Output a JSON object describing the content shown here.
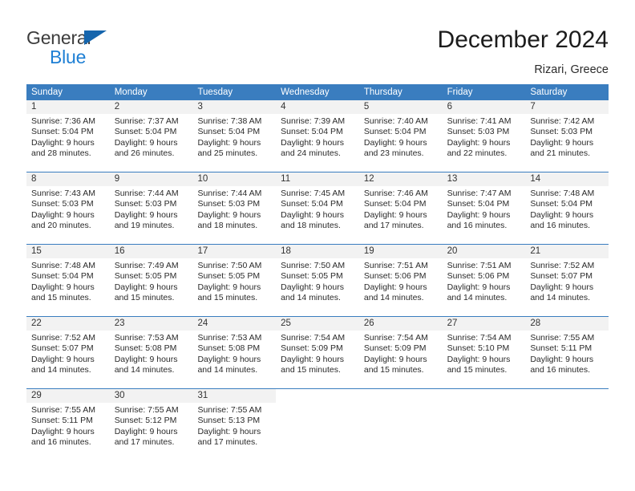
{
  "brand": {
    "name_part1": "General",
    "name_part2": "Blue",
    "triangle_color": "#1565ad",
    "blue_color": "#1e7fd4"
  },
  "header": {
    "title": "December 2024",
    "location": "Rizari, Greece"
  },
  "theme": {
    "header_blue": "#3a7dbf",
    "daynum_band": "#f2f2f2",
    "text": "#2a2a2a"
  },
  "calendar": {
    "weekday_headers": [
      "Sunday",
      "Monday",
      "Tuesday",
      "Wednesday",
      "Thursday",
      "Friday",
      "Saturday"
    ],
    "weeks": [
      [
        {
          "day": "1",
          "sunrise": "Sunrise: 7:36 AM",
          "sunset": "Sunset: 5:04 PM",
          "daylight1": "Daylight: 9 hours",
          "daylight2": "and 28 minutes."
        },
        {
          "day": "2",
          "sunrise": "Sunrise: 7:37 AM",
          "sunset": "Sunset: 5:04 PM",
          "daylight1": "Daylight: 9 hours",
          "daylight2": "and 26 minutes."
        },
        {
          "day": "3",
          "sunrise": "Sunrise: 7:38 AM",
          "sunset": "Sunset: 5:04 PM",
          "daylight1": "Daylight: 9 hours",
          "daylight2": "and 25 minutes."
        },
        {
          "day": "4",
          "sunrise": "Sunrise: 7:39 AM",
          "sunset": "Sunset: 5:04 PM",
          "daylight1": "Daylight: 9 hours",
          "daylight2": "and 24 minutes."
        },
        {
          "day": "5",
          "sunrise": "Sunrise: 7:40 AM",
          "sunset": "Sunset: 5:04 PM",
          "daylight1": "Daylight: 9 hours",
          "daylight2": "and 23 minutes."
        },
        {
          "day": "6",
          "sunrise": "Sunrise: 7:41 AM",
          "sunset": "Sunset: 5:03 PM",
          "daylight1": "Daylight: 9 hours",
          "daylight2": "and 22 minutes."
        },
        {
          "day": "7",
          "sunrise": "Sunrise: 7:42 AM",
          "sunset": "Sunset: 5:03 PM",
          "daylight1": "Daylight: 9 hours",
          "daylight2": "and 21 minutes."
        }
      ],
      [
        {
          "day": "8",
          "sunrise": "Sunrise: 7:43 AM",
          "sunset": "Sunset: 5:03 PM",
          "daylight1": "Daylight: 9 hours",
          "daylight2": "and 20 minutes."
        },
        {
          "day": "9",
          "sunrise": "Sunrise: 7:44 AM",
          "sunset": "Sunset: 5:03 PM",
          "daylight1": "Daylight: 9 hours",
          "daylight2": "and 19 minutes."
        },
        {
          "day": "10",
          "sunrise": "Sunrise: 7:44 AM",
          "sunset": "Sunset: 5:03 PM",
          "daylight1": "Daylight: 9 hours",
          "daylight2": "and 18 minutes."
        },
        {
          "day": "11",
          "sunrise": "Sunrise: 7:45 AM",
          "sunset": "Sunset: 5:04 PM",
          "daylight1": "Daylight: 9 hours",
          "daylight2": "and 18 minutes."
        },
        {
          "day": "12",
          "sunrise": "Sunrise: 7:46 AM",
          "sunset": "Sunset: 5:04 PM",
          "daylight1": "Daylight: 9 hours",
          "daylight2": "and 17 minutes."
        },
        {
          "day": "13",
          "sunrise": "Sunrise: 7:47 AM",
          "sunset": "Sunset: 5:04 PM",
          "daylight1": "Daylight: 9 hours",
          "daylight2": "and 16 minutes."
        },
        {
          "day": "14",
          "sunrise": "Sunrise: 7:48 AM",
          "sunset": "Sunset: 5:04 PM",
          "daylight1": "Daylight: 9 hours",
          "daylight2": "and 16 minutes."
        }
      ],
      [
        {
          "day": "15",
          "sunrise": "Sunrise: 7:48 AM",
          "sunset": "Sunset: 5:04 PM",
          "daylight1": "Daylight: 9 hours",
          "daylight2": "and 15 minutes."
        },
        {
          "day": "16",
          "sunrise": "Sunrise: 7:49 AM",
          "sunset": "Sunset: 5:05 PM",
          "daylight1": "Daylight: 9 hours",
          "daylight2": "and 15 minutes."
        },
        {
          "day": "17",
          "sunrise": "Sunrise: 7:50 AM",
          "sunset": "Sunset: 5:05 PM",
          "daylight1": "Daylight: 9 hours",
          "daylight2": "and 15 minutes."
        },
        {
          "day": "18",
          "sunrise": "Sunrise: 7:50 AM",
          "sunset": "Sunset: 5:05 PM",
          "daylight1": "Daylight: 9 hours",
          "daylight2": "and 14 minutes."
        },
        {
          "day": "19",
          "sunrise": "Sunrise: 7:51 AM",
          "sunset": "Sunset: 5:06 PM",
          "daylight1": "Daylight: 9 hours",
          "daylight2": "and 14 minutes."
        },
        {
          "day": "20",
          "sunrise": "Sunrise: 7:51 AM",
          "sunset": "Sunset: 5:06 PM",
          "daylight1": "Daylight: 9 hours",
          "daylight2": "and 14 minutes."
        },
        {
          "day": "21",
          "sunrise": "Sunrise: 7:52 AM",
          "sunset": "Sunset: 5:07 PM",
          "daylight1": "Daylight: 9 hours",
          "daylight2": "and 14 minutes."
        }
      ],
      [
        {
          "day": "22",
          "sunrise": "Sunrise: 7:52 AM",
          "sunset": "Sunset: 5:07 PM",
          "daylight1": "Daylight: 9 hours",
          "daylight2": "and 14 minutes."
        },
        {
          "day": "23",
          "sunrise": "Sunrise: 7:53 AM",
          "sunset": "Sunset: 5:08 PM",
          "daylight1": "Daylight: 9 hours",
          "daylight2": "and 14 minutes."
        },
        {
          "day": "24",
          "sunrise": "Sunrise: 7:53 AM",
          "sunset": "Sunset: 5:08 PM",
          "daylight1": "Daylight: 9 hours",
          "daylight2": "and 14 minutes."
        },
        {
          "day": "25",
          "sunrise": "Sunrise: 7:54 AM",
          "sunset": "Sunset: 5:09 PM",
          "daylight1": "Daylight: 9 hours",
          "daylight2": "and 15 minutes."
        },
        {
          "day": "26",
          "sunrise": "Sunrise: 7:54 AM",
          "sunset": "Sunset: 5:09 PM",
          "daylight1": "Daylight: 9 hours",
          "daylight2": "and 15 minutes."
        },
        {
          "day": "27",
          "sunrise": "Sunrise: 7:54 AM",
          "sunset": "Sunset: 5:10 PM",
          "daylight1": "Daylight: 9 hours",
          "daylight2": "and 15 minutes."
        },
        {
          "day": "28",
          "sunrise": "Sunrise: 7:55 AM",
          "sunset": "Sunset: 5:11 PM",
          "daylight1": "Daylight: 9 hours",
          "daylight2": "and 16 minutes."
        }
      ],
      [
        {
          "day": "29",
          "sunrise": "Sunrise: 7:55 AM",
          "sunset": "Sunset: 5:11 PM",
          "daylight1": "Daylight: 9 hours",
          "daylight2": "and 16 minutes."
        },
        {
          "day": "30",
          "sunrise": "Sunrise: 7:55 AM",
          "sunset": "Sunset: 5:12 PM",
          "daylight1": "Daylight: 9 hours",
          "daylight2": "and 17 minutes."
        },
        {
          "day": "31",
          "sunrise": "Sunrise: 7:55 AM",
          "sunset": "Sunset: 5:13 PM",
          "daylight1": "Daylight: 9 hours",
          "daylight2": "and 17 minutes."
        },
        {
          "day": "",
          "sunrise": "",
          "sunset": "",
          "daylight1": "",
          "daylight2": ""
        },
        {
          "day": "",
          "sunrise": "",
          "sunset": "",
          "daylight1": "",
          "daylight2": ""
        },
        {
          "day": "",
          "sunrise": "",
          "sunset": "",
          "daylight1": "",
          "daylight2": ""
        },
        {
          "day": "",
          "sunrise": "",
          "sunset": "",
          "daylight1": "",
          "daylight2": ""
        }
      ]
    ]
  }
}
